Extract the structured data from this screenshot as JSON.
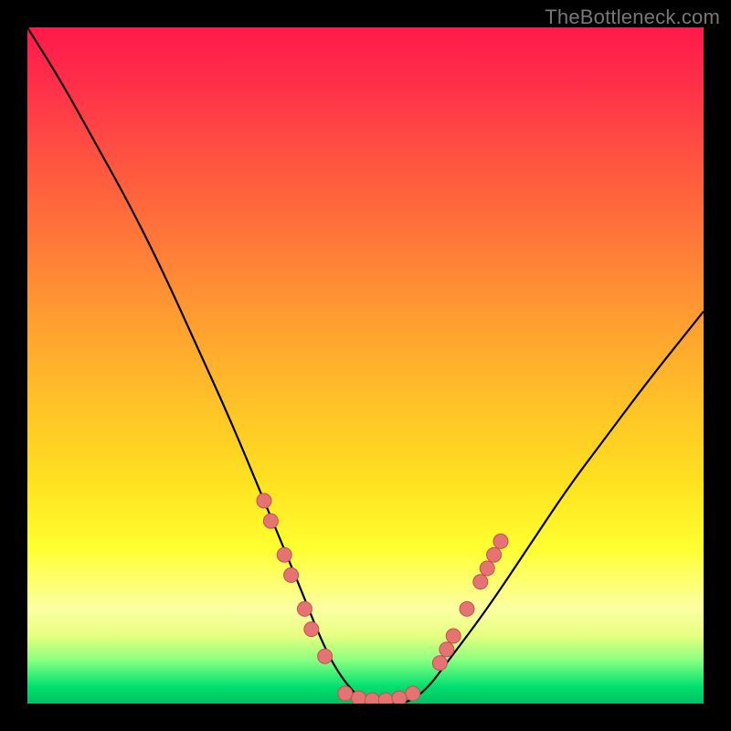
{
  "watermark": "TheBottleneck.com",
  "chart_data": {
    "type": "line",
    "title": "",
    "xlabel": "",
    "ylabel": "",
    "xlim": [
      0,
      100
    ],
    "ylim": [
      0,
      100
    ],
    "grid": false,
    "legend": false,
    "background_gradient": [
      "#ff1a4a",
      "#ff7a38",
      "#ffe020",
      "#ffff30",
      "#00e070"
    ],
    "series": [
      {
        "name": "bottleneck-curve",
        "color": "#000000",
        "x": [
          0,
          5,
          10,
          15,
          20,
          25,
          30,
          35,
          40,
          44,
          47,
          50,
          53,
          56,
          59,
          62,
          68,
          74,
          80,
          86,
          92,
          100
        ],
        "y": [
          100,
          92,
          83,
          74,
          64,
          53,
          42,
          30,
          18,
          8,
          3,
          0,
          0,
          0,
          2,
          6,
          14,
          23,
          32,
          40,
          48,
          58
        ]
      }
    ],
    "markers": [
      {
        "name": "left-cluster",
        "shape": "circle",
        "color_fill": "#e57373",
        "color_stroke": "#c94f4f",
        "points": [
          {
            "x": 35,
            "y": 30
          },
          {
            "x": 36,
            "y": 27
          },
          {
            "x": 38,
            "y": 22
          },
          {
            "x": 39,
            "y": 19
          },
          {
            "x": 41,
            "y": 14
          },
          {
            "x": 42,
            "y": 11
          },
          {
            "x": 44,
            "y": 7
          }
        ]
      },
      {
        "name": "bottom-cluster",
        "shape": "circle",
        "color_fill": "#e57373",
        "color_stroke": "#c94f4f",
        "points": [
          {
            "x": 47,
            "y": 1.5
          },
          {
            "x": 49,
            "y": 0.8
          },
          {
            "x": 51,
            "y": 0.5
          },
          {
            "x": 53,
            "y": 0.5
          },
          {
            "x": 55,
            "y": 0.8
          },
          {
            "x": 57,
            "y": 1.5
          }
        ]
      },
      {
        "name": "right-cluster",
        "shape": "circle",
        "color_fill": "#e57373",
        "color_stroke": "#c94f4f",
        "points": [
          {
            "x": 61,
            "y": 6
          },
          {
            "x": 62,
            "y": 8
          },
          {
            "x": 63,
            "y": 10
          },
          {
            "x": 65,
            "y": 14
          },
          {
            "x": 67,
            "y": 18
          },
          {
            "x": 68,
            "y": 20
          },
          {
            "x": 69,
            "y": 22
          },
          {
            "x": 70,
            "y": 24
          }
        ]
      }
    ]
  }
}
